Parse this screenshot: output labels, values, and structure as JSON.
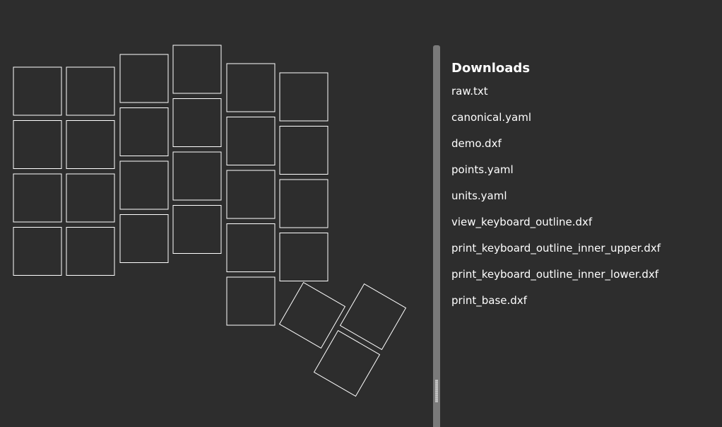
{
  "downloads": {
    "title": "Downloads",
    "files": [
      "raw.txt",
      "canonical.yaml",
      "demo.dxf",
      "points.yaml",
      "units.yaml",
      "view_keyboard_outline.dxf",
      "print_keyboard_outline_inner_upper.dxf",
      "print_keyboard_outline_inner_lower.dxf",
      "print_base.dxf"
    ]
  },
  "preview": {
    "key_outline_color": "#ffffff",
    "background_color": "#2d2d2d",
    "splitter_color": "#7a7a7a"
  }
}
